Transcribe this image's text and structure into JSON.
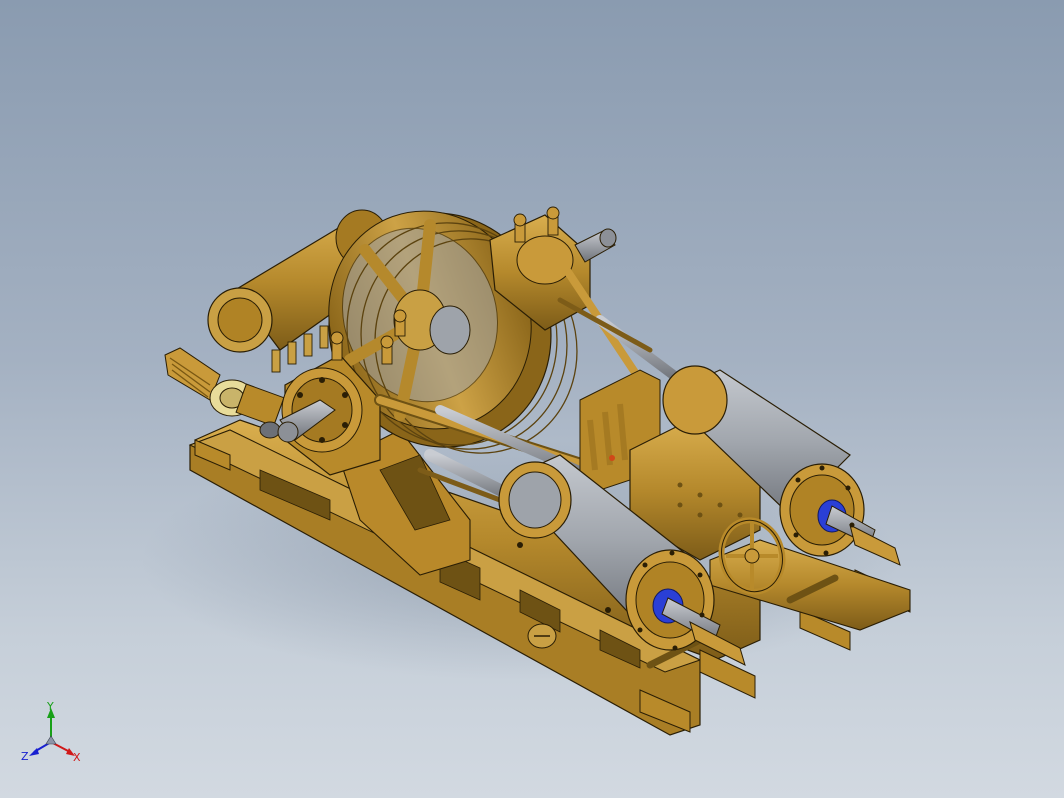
{
  "viewport": {
    "background_top": "#8a9bb0",
    "background_bottom": "#d2d9e1"
  },
  "model": {
    "colors": {
      "brass": "#b5892c",
      "brass_light": "#d4a94a",
      "brass_dark": "#6e5214",
      "steel": "#9ea3aa",
      "steel_light": "#bfc3c9",
      "steel_dark": "#6c7077",
      "bearing_blue": "#2a3fd6",
      "pale_brass": "#e8dc9a",
      "outline": "#2a1e05"
    }
  },
  "triad": {
    "x_label": "X",
    "y_label": "Y",
    "z_label": "Z",
    "x_color": "#d01818",
    "y_color": "#18a018",
    "z_color": "#1820d0"
  }
}
